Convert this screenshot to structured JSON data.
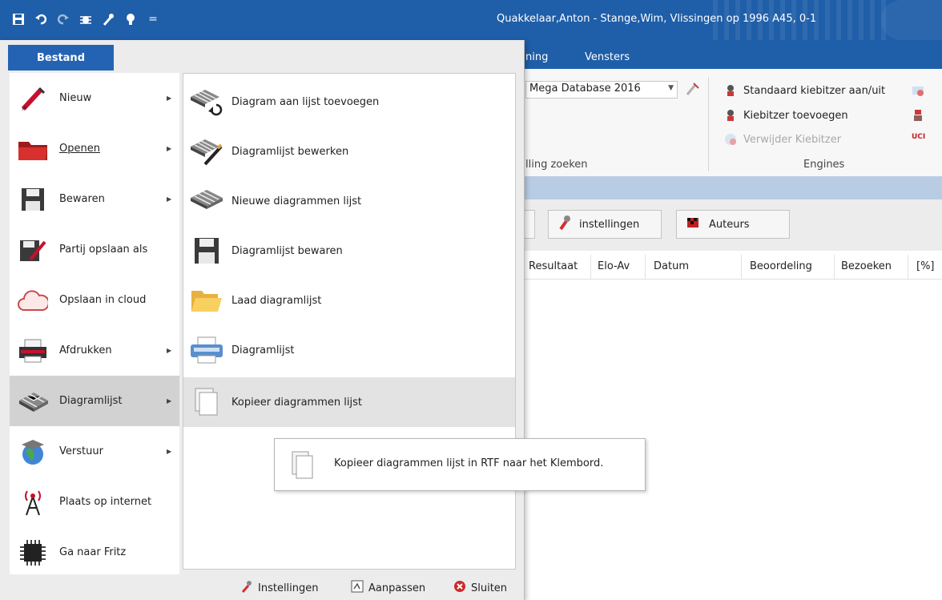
{
  "window": {
    "title": "Quakkelaar,Anton - Stange,Wim, Vlissingen op 1996  A45, 0-1"
  },
  "quick_access": {
    "overflow_glyph": "="
  },
  "ribbon_tabs": [
    {
      "label": "ning"
    },
    {
      "label": "Vensters"
    }
  ],
  "ribbon": {
    "database_combo": "Mega Database 2016",
    "find_position_label": "lling zoeken",
    "engines_group_label": "Engines",
    "engine_items": [
      {
        "label": "Standaard kiebitzer aan/uit"
      },
      {
        "label": "Kiebitzer toevoegen"
      },
      {
        "label": "Verwijder Kiebitzer"
      }
    ],
    "uci_badge": "UCI"
  },
  "toolbar": {
    "settings_button": "instellingen",
    "authors_button": "Auteurs"
  },
  "columns": [
    "Resultaat",
    "Elo-Av",
    "Datum",
    "Beoordeling",
    "Bezoeken",
    "[%]"
  ],
  "menu": {
    "tab_label": "Bestand",
    "items": [
      {
        "label": "Nieuw",
        "has_submenu": true,
        "icon": "pencil-icon"
      },
      {
        "label": "Openen",
        "has_submenu": true,
        "icon": "folder-icon"
      },
      {
        "label": "Bewaren",
        "has_submenu": true,
        "icon": "floppy-icon"
      },
      {
        "label": "Partij opslaan als",
        "has_submenu": false,
        "icon": "save-as-icon"
      },
      {
        "label": "Opslaan in cloud",
        "has_submenu": false,
        "icon": "cloud-icon"
      },
      {
        "label": "Afdrukken",
        "has_submenu": true,
        "icon": "printer-icon"
      },
      {
        "label": "Diagramlijst",
        "has_submenu": true,
        "icon": "chessboard-icon",
        "selected": true
      },
      {
        "label": "Verstuur",
        "has_submenu": true,
        "icon": "globe-icon"
      },
      {
        "label": "Plaats op internet",
        "has_submenu": false,
        "icon": "antenna-icon"
      },
      {
        "label": "Ga naar Fritz",
        "has_submenu": false,
        "icon": "chip-icon"
      }
    ],
    "submenu": [
      {
        "label": "Diagram aan lijst toevoegen",
        "icon": "chessboard-add-icon"
      },
      {
        "label": "Diagramlijst bewerken",
        "icon": "chessboard-edit-icon"
      },
      {
        "label": "Nieuwe diagrammen lijst",
        "icon": "chessboard-new-icon"
      },
      {
        "label": "Diagramlijst bewaren",
        "icon": "floppy-icon"
      },
      {
        "label": "Laad diagramlijst",
        "icon": "folder-open-icon"
      },
      {
        "label": "Diagramlijst",
        "icon": "printer-icon"
      },
      {
        "label": "Kopieer diagrammen lijst",
        "icon": "copy-icon",
        "selected": true
      }
    ],
    "footer": {
      "settings": "Instellingen",
      "customize": "Aanpassen",
      "close": "Sluiten"
    }
  },
  "tooltip": {
    "text": "Kopieer diagrammen lijst in RTF naar het Klembord."
  }
}
